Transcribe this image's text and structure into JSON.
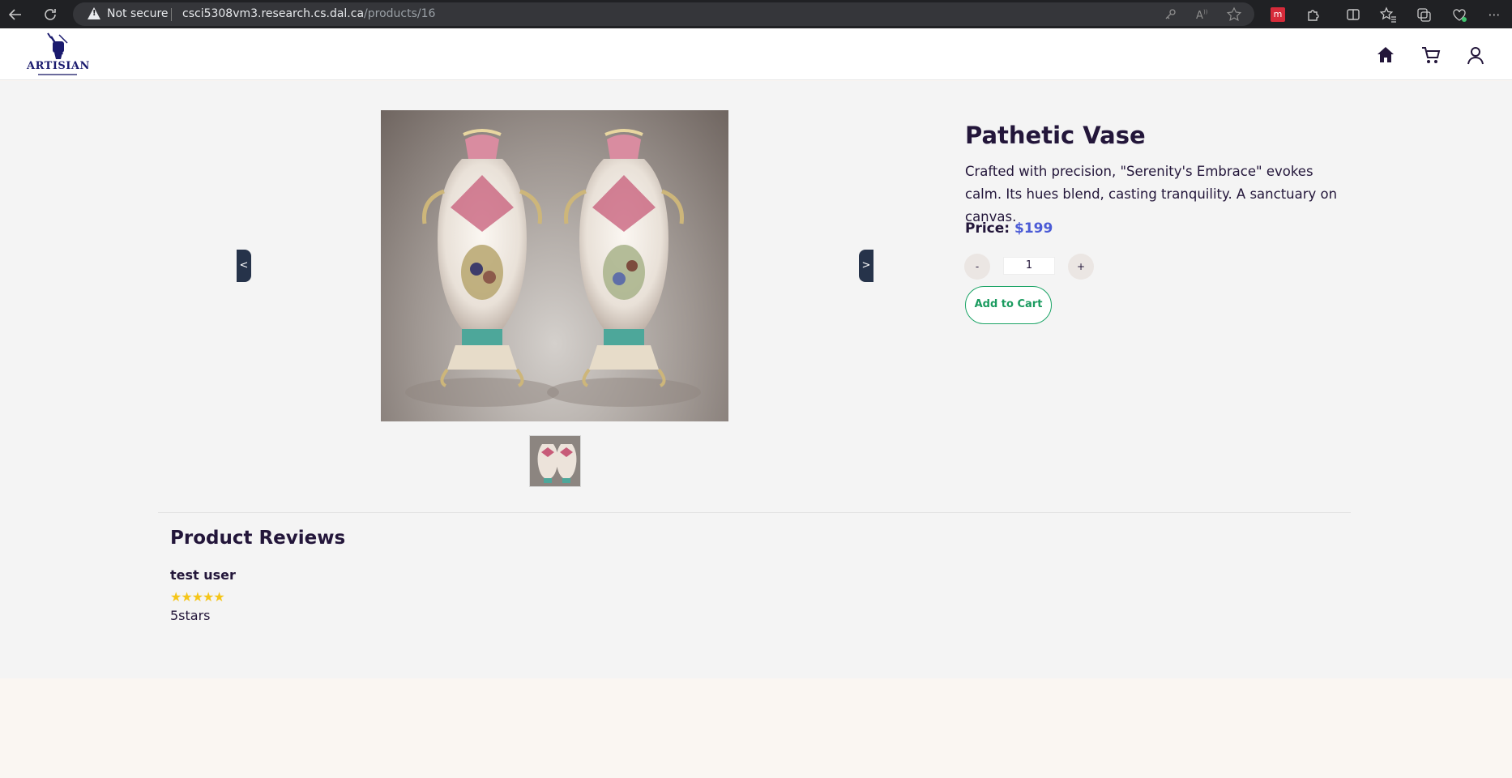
{
  "browser": {
    "security_label": "Not secure",
    "url_host": "csci5308vm3.research.cs.dal.ca",
    "url_path": "/products/16",
    "icons": [
      "back-icon",
      "refresh-icon",
      "key-icon",
      "read-aloud-icon",
      "favorite-star-icon",
      "extension-red-icon",
      "puzzle-icon",
      "split-screen-icon",
      "favorites-icon",
      "collections-icon",
      "health-icon",
      "more-icon"
    ]
  },
  "header": {
    "logo_text": "ARTISIAN",
    "icons": [
      "home-icon",
      "cart-icon",
      "user-icon"
    ]
  },
  "product": {
    "title": "Pathetic Vase",
    "description": "Crafted with precision, \"Serenity's Embrace\" evokes calm. Its hues blend, casting tranquility. A sanctuary on canvas.",
    "price_label": "Price:",
    "price_value": "$199",
    "quantity": "1",
    "decrement_label": "-",
    "increment_label": "+",
    "add_to_cart_label": "Add to Cart",
    "prev_label": "<",
    "next_label": ">"
  },
  "reviews": {
    "title": "Product Reviews",
    "items": [
      {
        "user": "test user",
        "stars": "★★★★★",
        "rating": 5,
        "text": "5stars"
      }
    ]
  },
  "colors": {
    "accent_text": "#23163a",
    "price": "#4b5bd6",
    "cart_button": "#1ba466",
    "carousel_arrow": "#26334a",
    "star": "#f5c518"
  }
}
